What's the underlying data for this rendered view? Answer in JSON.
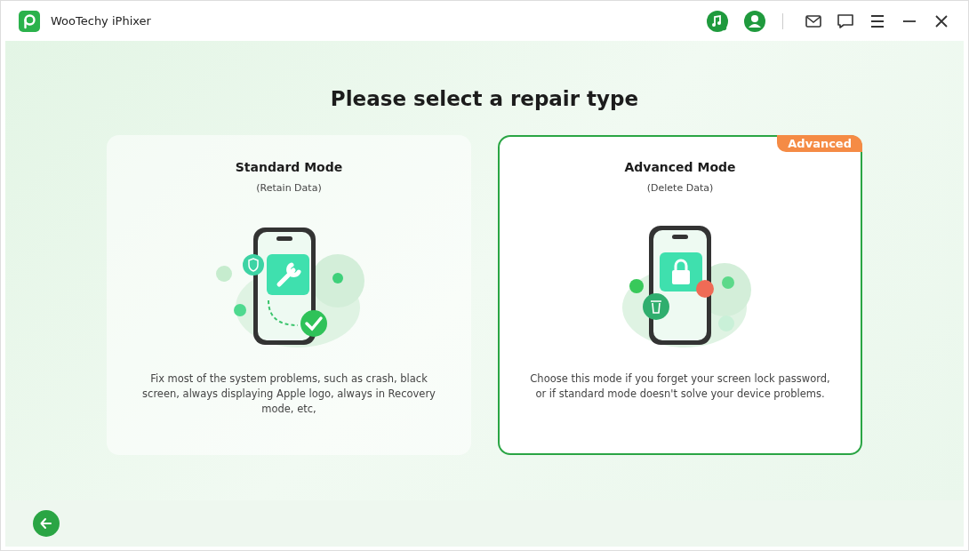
{
  "window": {
    "title": "WooTechy iPhixer"
  },
  "heading": "Please select a repair type",
  "modes": [
    {
      "kind": "repair",
      "title": "Standard Mode",
      "subtitle": "(Retain Data)",
      "description": "Fix most of the system problems, such as crash, black screen, always displaying Apple logo, always in Recovery mode, etc,",
      "selected": false
    },
    {
      "kind": "unlock",
      "title": "Advanced Mode",
      "subtitle": "(Delete Data)",
      "description": "Choose this mode if you forget your screen lock password, or if standard mode doesn't solve your device problems.",
      "selected": true,
      "badge": "Advanced"
    }
  ]
}
